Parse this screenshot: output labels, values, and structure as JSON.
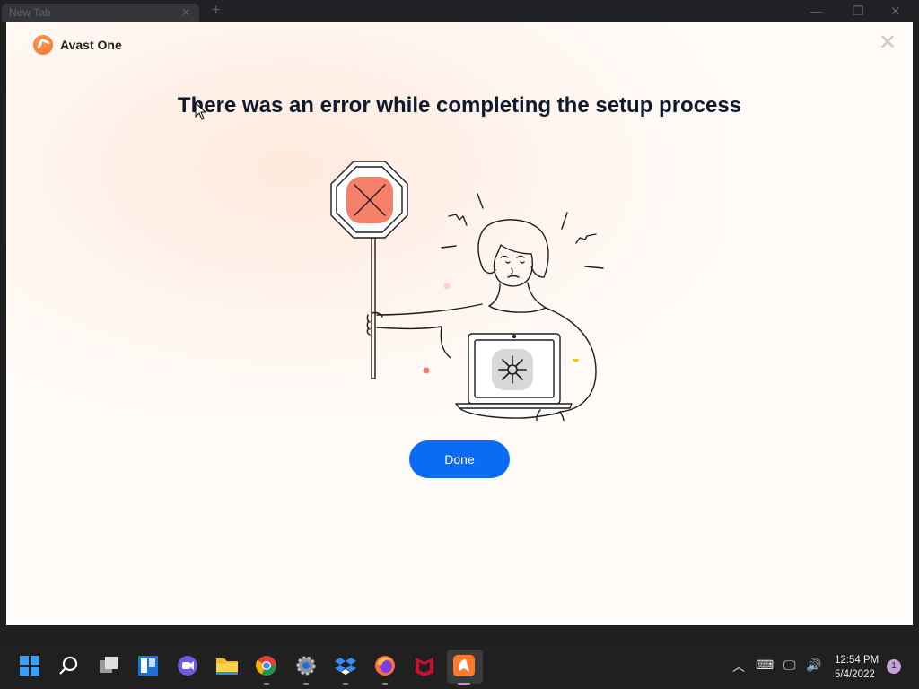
{
  "background_browser": {
    "tab_title": "New Tab"
  },
  "dialog": {
    "brand_name": "Avast One",
    "title": "There was an error while completing the setup process",
    "done_label": "Done"
  },
  "taskbar": {
    "apps": [
      {
        "name": "start",
        "icon": "windows-start-icon"
      },
      {
        "name": "search",
        "icon": "search-icon"
      },
      {
        "name": "task-view",
        "icon": "task-view-icon"
      },
      {
        "name": "widgets",
        "icon": "widgets-icon"
      },
      {
        "name": "teams-chat",
        "icon": "teams-chat-icon"
      },
      {
        "name": "file-explorer",
        "icon": "folder-icon"
      },
      {
        "name": "chrome",
        "icon": "chrome-icon"
      },
      {
        "name": "settings",
        "icon": "gear-icon"
      },
      {
        "name": "dropbox",
        "icon": "dropbox-icon"
      },
      {
        "name": "firefox",
        "icon": "firefox-icon"
      },
      {
        "name": "mcafee",
        "icon": "mcafee-icon"
      },
      {
        "name": "avast",
        "icon": "avast-icon"
      }
    ],
    "clock_time": "12:54 PM",
    "clock_date": "5/4/2022",
    "notification_count": "1"
  },
  "colors": {
    "accent": "#0a6cf5",
    "brand": "#ff6a1f",
    "stop_sign": "#f4806a"
  }
}
